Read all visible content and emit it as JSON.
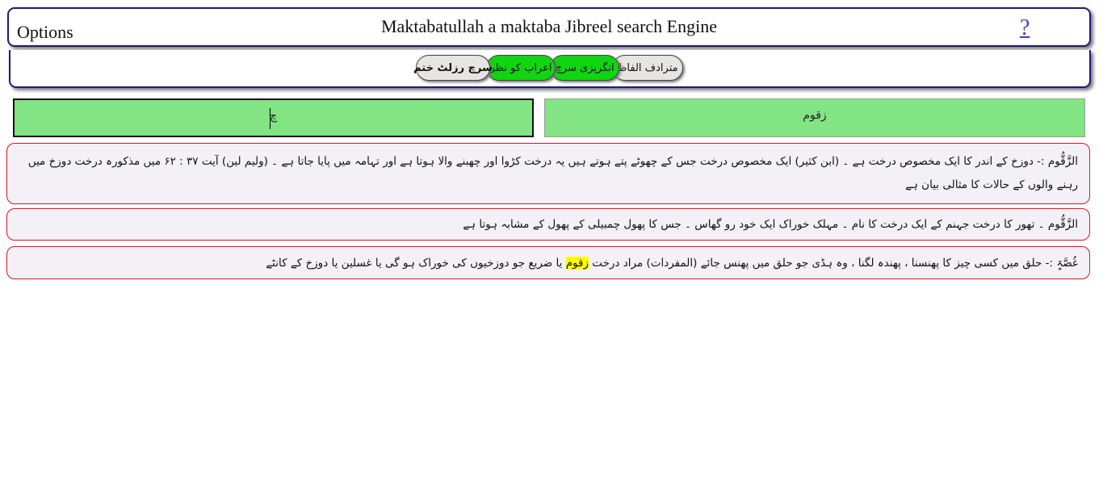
{
  "header": {
    "options_label": "Options",
    "title": "Maktabatullah a maktaba Jibreel search Engine",
    "help_label": "?"
  },
  "toolbar": {
    "buttons": [
      {
        "label": "مترادف الفاظ",
        "style": "gray",
        "color": "#e8e4e2"
      },
      {
        "label": "انگریزی سرچ",
        "style": "green",
        "color": "#11d511"
      },
      {
        "label": "اعراب کو نظر",
        "style": "green",
        "color": "#11d511"
      },
      {
        "label": "سرچ رزلٹ ختم",
        "style": "gray-bold",
        "color": "#e8e4e2"
      }
    ]
  },
  "search": {
    "left_value": "چ",
    "right_value": "زقوم",
    "box_color": "#82e482"
  },
  "results": [
    {
      "text": "الزَّقُّوم :- دوزخ کے اندر کا ایک مخصوص درخت ہے ۔ (ابن کثیر) ایک مخصوص درخت جس کے چھوٹے پتے ہوتے ہیں یہ درخت کڑوا اور چھبنے والا ہوتا ہے اور تہامہ میں پایا جاتا ہے ۔ (ولیم لین) آیت ۳۷ : ۶۲ میں مذکورہ درخت دوزخ میں رہنے والوں کے حالات کا مثالی بیان ہے"
    },
    {
      "text": "الزَّقُّوم ۔ تھور کا درخت جہنم کے ایک درخت کا نام ۔ مہلک خوراک ایک خود رو گھاس ۔ جس کا پھول چمبیلی کے پھول کے مشابہ ہوتا ہے"
    },
    {
      "text_before": "غُصَّۃٍ :- حلق میں کسی چیز کا پھنسنا ، پھندہ لگنا ، وہ ہڈی جو حلق میں پھنس جائے (المفردات) مراد درخت ",
      "highlight": "زقوم",
      "text_after": " یا ضریع جو دوزخیوں کی خوراک ہو گی یا غسلین یا دوزخ کے کانٹے",
      "highlight_color": "#ffff00"
    }
  ],
  "colors": {
    "frame_border": "#1a1a80",
    "result_border": "#e0102a",
    "result_bg": "#f3f1f5"
  }
}
